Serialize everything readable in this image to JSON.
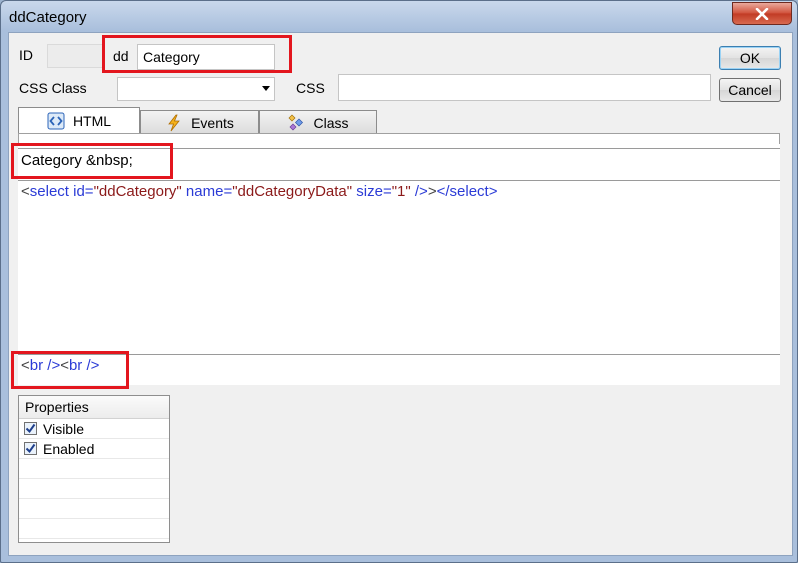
{
  "window": {
    "title": "ddCategory"
  },
  "form": {
    "id_label": "ID",
    "id_prefix": "dd",
    "id_value": "Category",
    "cssclass_label": "CSS Class",
    "cssclass_value": "",
    "css_label": "CSS",
    "css_value": ""
  },
  "buttons": {
    "ok": "OK",
    "cancel": "Cancel"
  },
  "tabs": [
    {
      "label": "HTML",
      "icon": "html-code-icon",
      "active": true
    },
    {
      "label": "Events",
      "icon": "lightning-icon",
      "active": false
    },
    {
      "label": "Class",
      "icon": "class-icon",
      "active": false
    }
  ],
  "editor": {
    "before_text": "Category &nbsp;",
    "main_code": {
      "open_tag_start": "<select",
      "attr1": " id=",
      "val1": "\"ddCategory\"",
      "attr2": " name=",
      "val2": "\"ddCategoryData\"",
      "attr3": " size=",
      "val3": "\"1\"",
      "self_close": " />",
      "close_tag": "</select>",
      "closing_bracket": ">"
    },
    "after_code": {
      "br1_lt": "<",
      "br1": "br />",
      "br2_lt": "<",
      "br2": "br />"
    }
  },
  "properties": {
    "header": "Properties",
    "items": [
      {
        "label": "Visible",
        "checked": true
      },
      {
        "label": "Enabled",
        "checked": true
      }
    ]
  },
  "colors": {
    "highlight": "#e3161e"
  }
}
